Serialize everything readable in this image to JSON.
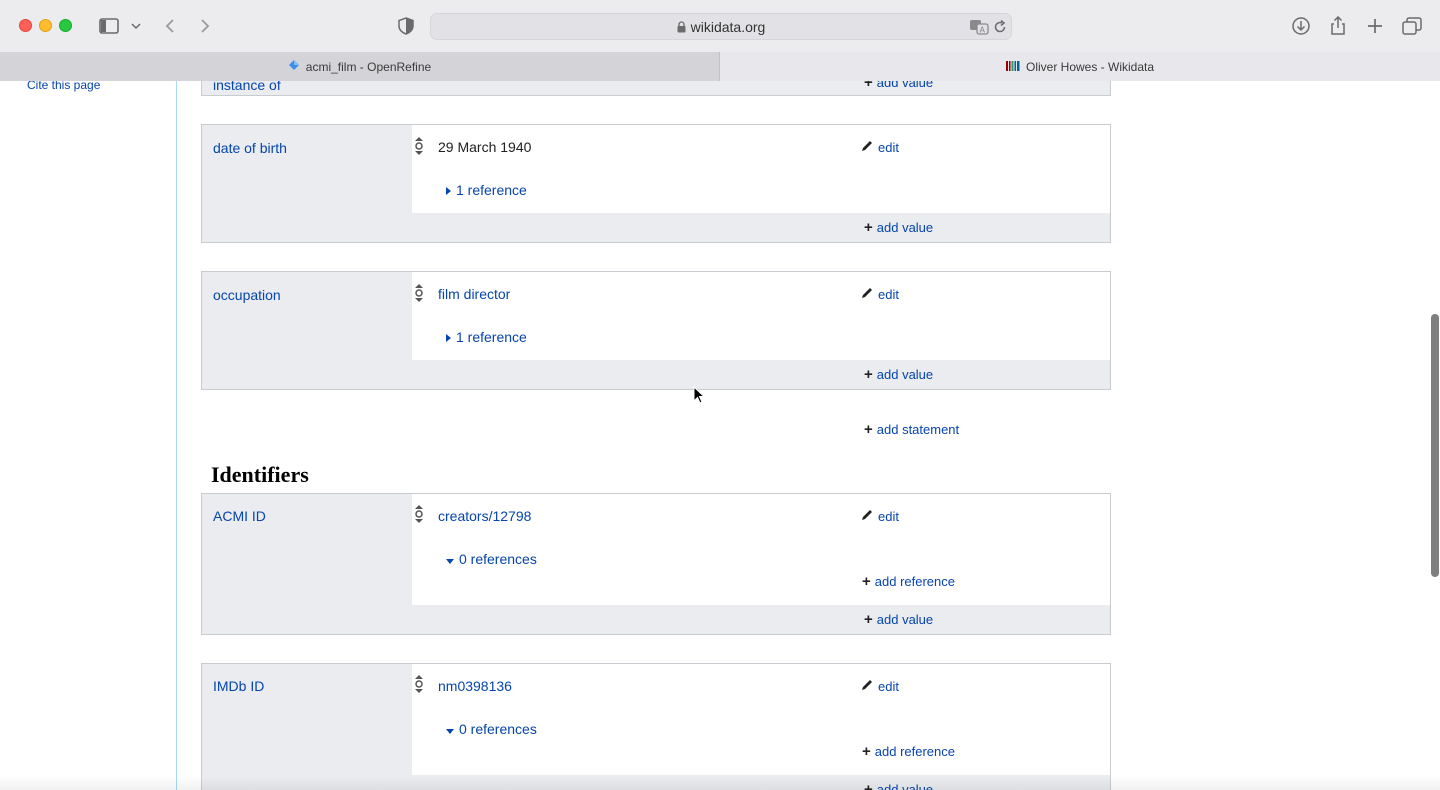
{
  "browser": {
    "url": "wikidata.org",
    "tabs": [
      {
        "label": "acmi_film - OpenRefine",
        "active": false
      },
      {
        "label": "Oliver Howes - Wikidata",
        "active": true
      }
    ]
  },
  "sidebar": {
    "cite_label": "Cite this page"
  },
  "labels": {
    "edit": "edit",
    "add_value": "add value",
    "add_reference": "add reference",
    "add_statement": "add statement"
  },
  "statements": {
    "instance_of": {
      "property": "instance of"
    },
    "date_of_birth": {
      "property": "date of birth",
      "value": "29 March 1940",
      "references": "1 reference"
    },
    "occupation": {
      "property": "occupation",
      "value": "film director",
      "references": "1 reference"
    }
  },
  "identifiers": {
    "heading": "Identifiers",
    "acmi_id": {
      "property": "ACMI ID",
      "value": "creators/12798",
      "references": "0 references"
    },
    "imdb_id": {
      "property": "IMDb ID",
      "value": "nm0398136",
      "references": "0 references"
    }
  }
}
